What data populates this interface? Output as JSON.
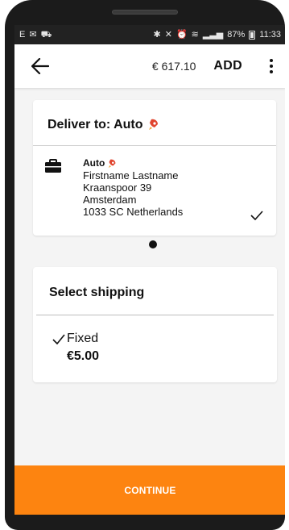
{
  "status_bar": {
    "left_icons": [
      "E",
      "✉",
      "⛟"
    ],
    "battery_text": "87%",
    "time": "11:33"
  },
  "app_bar": {
    "total": "€ 617.10",
    "add_label": "ADD"
  },
  "deliver": {
    "title": "Deliver to: Auto",
    "name": "Auto",
    "lines": [
      "Firstname Lastname",
      "Kraanspoor 39",
      "Amsterdam",
      "1033 SC Netherlands"
    ]
  },
  "shipping": {
    "title": "Select shipping",
    "option_name": "Fixed",
    "option_price": "€5.00"
  },
  "continue_label": "CONTINUE",
  "colors": {
    "accent": "#fd8410",
    "brand_icon": "#e0452f"
  },
  "icons": [
    "back-arrow-icon",
    "more-vert-icon",
    "briefcase-icon",
    "rocket-icon",
    "checkmark-icon"
  ]
}
